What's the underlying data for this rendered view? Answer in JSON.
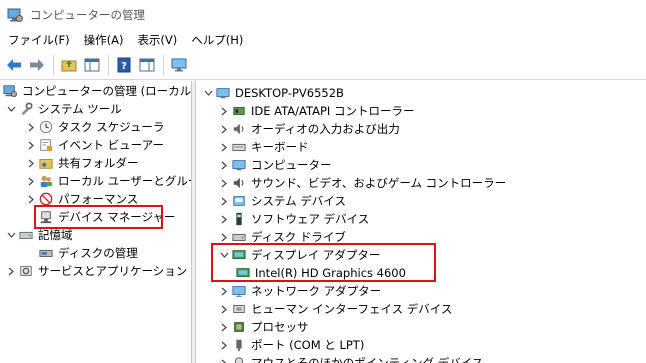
{
  "window": {
    "title": "コンピューターの管理"
  },
  "menu": [
    "ファイル(F)",
    "操作(A)",
    "表示(V)",
    "ヘルプ(H)"
  ],
  "toolbar": {
    "icons": [
      "back-arrow-icon",
      "forward-arrow-icon",
      "up-folder-icon",
      "show-hide-tree-icon",
      "help-icon",
      "properties-icon",
      "monitor-icon"
    ]
  },
  "left_tree": {
    "root": "コンピューターの管理 (ローカル)",
    "system_tools": "システム ツール",
    "task_scheduler": "タスク スケジューラ",
    "event_viewer": "イベント ビューアー",
    "shared_folders": "共有フォルダー",
    "local_users": "ローカル ユーザーとグループ",
    "performance": "パフォーマンス",
    "device_manager": "デバイス マネージャー",
    "storage": "記憶域",
    "disk_management": "ディスクの管理",
    "services_apps": "サービスとアプリケーション"
  },
  "right_tree": {
    "computer_name": "DESKTOP-PV6552B",
    "categories": [
      {
        "label": "IDE ATA/ATAPI コントローラー",
        "icon": "ide-controller-icon"
      },
      {
        "label": "オーディオの入力および出力",
        "icon": "speaker-icon"
      },
      {
        "label": "キーボード",
        "icon": "keyboard-icon"
      },
      {
        "label": "コンピューター",
        "icon": "computer-icon"
      },
      {
        "label": "サウンド、ビデオ、およびゲーム コントローラー",
        "icon": "sound-icon"
      },
      {
        "label": "システム デバイス",
        "icon": "system-device-icon"
      },
      {
        "label": "ソフトウェア デバイス",
        "icon": "software-device-icon"
      },
      {
        "label": "ディスク ドライブ",
        "icon": "disk-drive-icon"
      },
      {
        "label": "ディスプレイ アダプター",
        "icon": "display-adapter-icon"
      },
      {
        "label": "Intel(R) HD Graphics 4600",
        "icon": "display-adapter-icon"
      },
      {
        "label": "ネットワーク アダプター",
        "icon": "network-adapter-icon"
      },
      {
        "label": "ヒューマン インターフェイス デバイス",
        "icon": "hid-icon"
      },
      {
        "label": "プロセッサ",
        "icon": "processor-icon"
      },
      {
        "label": "ポート (COM と LPT)",
        "icon": "port-icon"
      },
      {
        "label": "マウスとそのほかのポインティング デバイス",
        "icon": "mouse-icon"
      }
    ]
  },
  "colors": {
    "highlight": "#d9131a",
    "accent": "#2b7cd3"
  }
}
